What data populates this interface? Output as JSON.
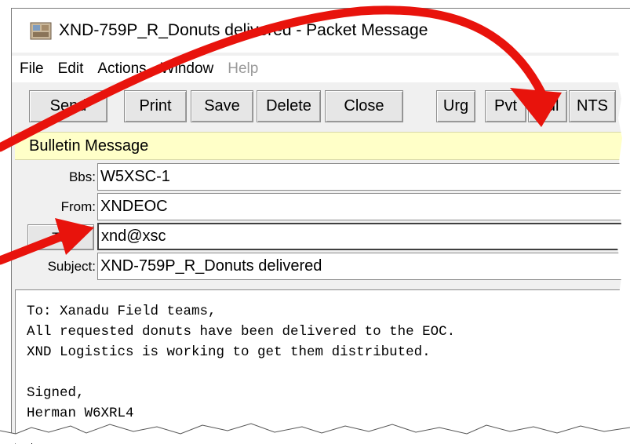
{
  "window": {
    "title": "XND-759P_R_Donuts delivered - Packet Message",
    "app_icon": "packet-app-icon"
  },
  "menu": {
    "items": [
      {
        "label": "File",
        "enabled": true
      },
      {
        "label": "Edit",
        "enabled": true
      },
      {
        "label": "Actions",
        "enabled": true
      },
      {
        "label": "Window",
        "enabled": true
      },
      {
        "label": "Help",
        "enabled": false
      }
    ]
  },
  "toolbar": {
    "send": "Send",
    "print": "Print",
    "save": "Save",
    "delete": "Delete",
    "close": "Close",
    "urg": "Urg",
    "pvt": "Pvt",
    "bul": "Bul",
    "nts": "NTS"
  },
  "banner": {
    "text": "Bulletin Message",
    "color": "#ffffc8"
  },
  "fields": {
    "bbs": {
      "label": "Bbs:",
      "value": "W5XSC-1"
    },
    "from": {
      "label": "From:",
      "value": "XNDEOC"
    },
    "to": {
      "label": "To:",
      "value": "xnd@xsc"
    },
    "subject": {
      "label": "Subject:",
      "value": "XND-759P_R_Donuts delivered"
    }
  },
  "message_body": "To: Xanadu Field teams,\nAll requested donuts have been delivered to the EOC.\nXND Logistics is working to get them distributed.\n\nSigned,\nHerman W6XRL4",
  "annotations": {
    "arrow_color": "#e8130c"
  }
}
